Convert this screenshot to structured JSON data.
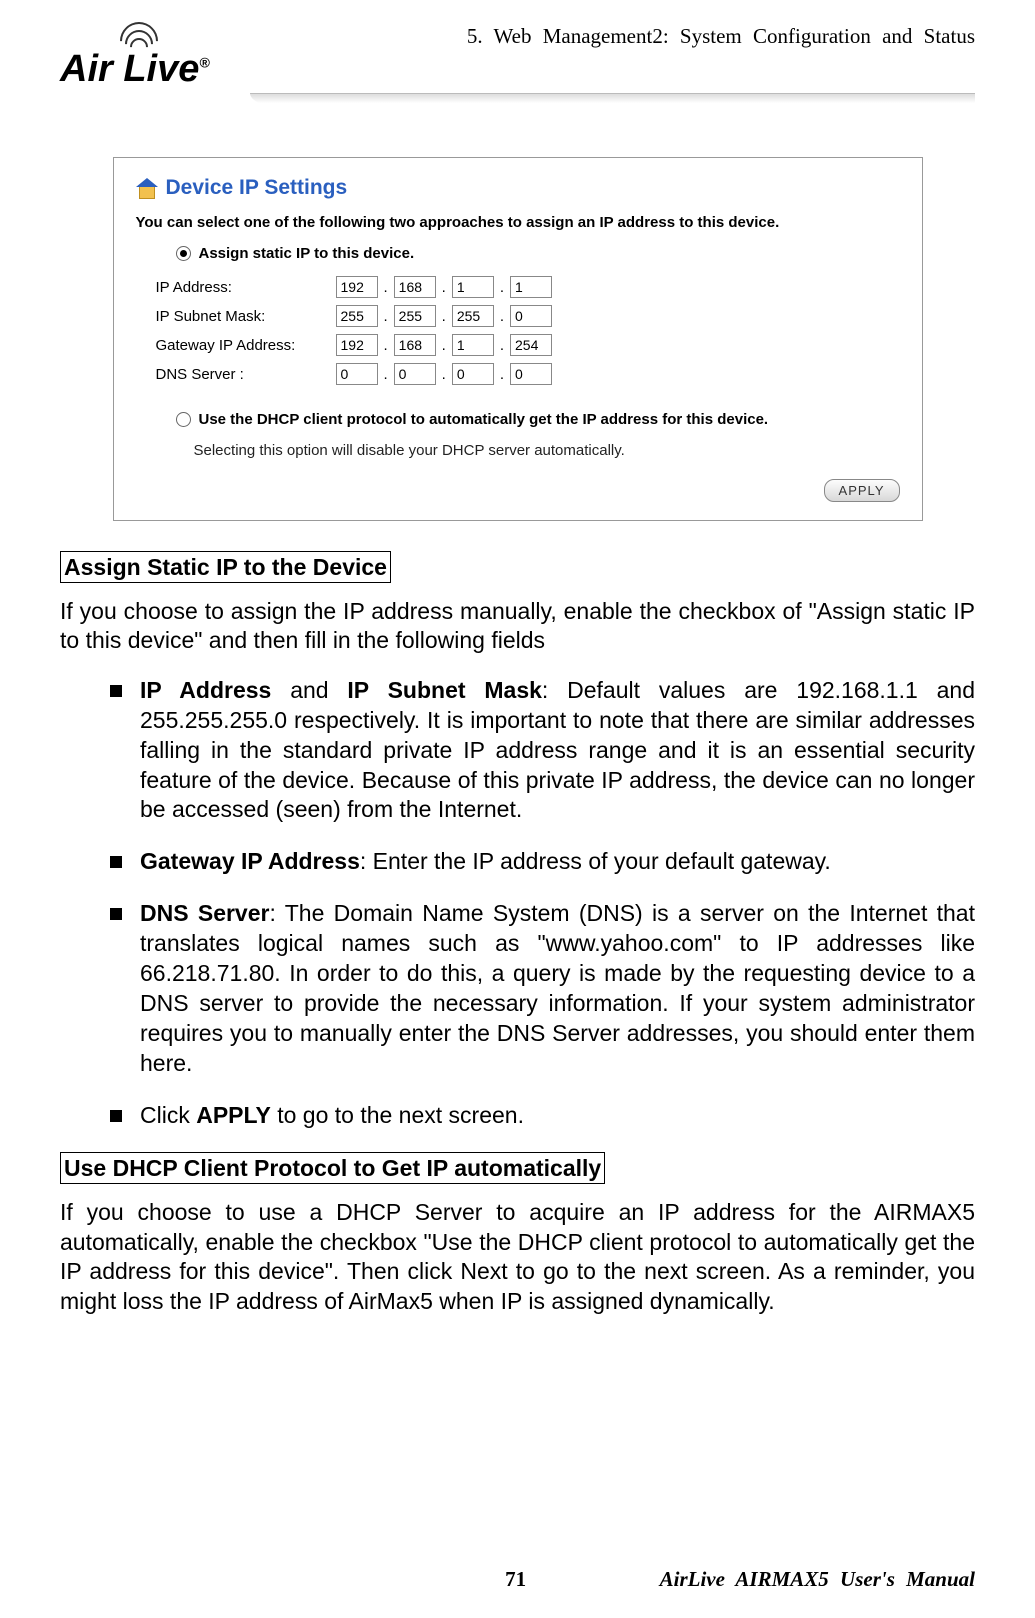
{
  "header": {
    "logo_text": "Air Live",
    "logo_reg": "®",
    "chapter": "5.  Web Management2: System Configuration and Status"
  },
  "screenshot": {
    "panel_title": "Device IP Settings",
    "intro": "You can select one of the following two approaches to assign an IP address to this device.",
    "radio_static": "Assign static IP to this device.",
    "labels": {
      "ip": "IP Address:",
      "mask": "IP Subnet Mask:",
      "gw": "Gateway IP Address:",
      "dns": "DNS Server :"
    },
    "values": {
      "ip": [
        "192",
        "168",
        "1",
        "1"
      ],
      "mask": [
        "255",
        "255",
        "255",
        "0"
      ],
      "gw": [
        "192",
        "168",
        "1",
        "254"
      ],
      "dns": [
        "0",
        "0",
        "0",
        "0"
      ]
    },
    "radio_dhcp": "Use the DHCP client protocol to automatically get the IP address for this device.",
    "dhcp_note": "Selecting this option will disable your DHCP server automatically.",
    "apply": "APPLY"
  },
  "section1": {
    "heading": "Assign Static IP to the Device",
    "para": "If you choose to assign the IP address manually, enable the checkbox of \"Assign static IP to this device\" and then fill in the following fields",
    "bullets": {
      "b1_bold1": "IP Address",
      "b1_mid": " and ",
      "b1_bold2": "IP Subnet Mask",
      "b1_rest": ": Default values are 192.168.1.1 and 255.255.255.0 respectively. It is important to note that there are similar addresses falling in the standard private IP address range and it is an essential security feature of the device. Because of this private IP address, the device can no longer be accessed (seen) from the Internet.",
      "b2_bold": "Gateway IP Address",
      "b2_rest": ": Enter the IP address of your default gateway.",
      "b3_bold": "DNS Server",
      "b3_rest": ": The Domain Name System (DNS) is a server on the Internet that translates logical names such as \"www.yahoo.com\" to IP addresses like 66.218.71.80. In order to do this, a query is made by the requesting device to a DNS server to provide the necessary information. If your system administrator requires you to manually enter the DNS Server addresses, you should enter them here.",
      "b4_pre": "Click ",
      "b4_bold": "APPLY",
      "b4_post": " to go to the next screen."
    }
  },
  "section2": {
    "heading": "Use DHCP Client Protocol to Get IP automatically",
    "para": "If you choose to use a DHCP Server to acquire an IP address for the AIRMAX5 automatically, enable the checkbox  \"Use the DHCP client protocol to automatically get the IP address for this device\". Then click Next to go to the next screen. As a reminder, you might loss the IP address of AirMax5 when IP is assigned dynamically."
  },
  "footer": {
    "page": "71",
    "manual": "AirLive AIRMAX5 User's Manual"
  }
}
